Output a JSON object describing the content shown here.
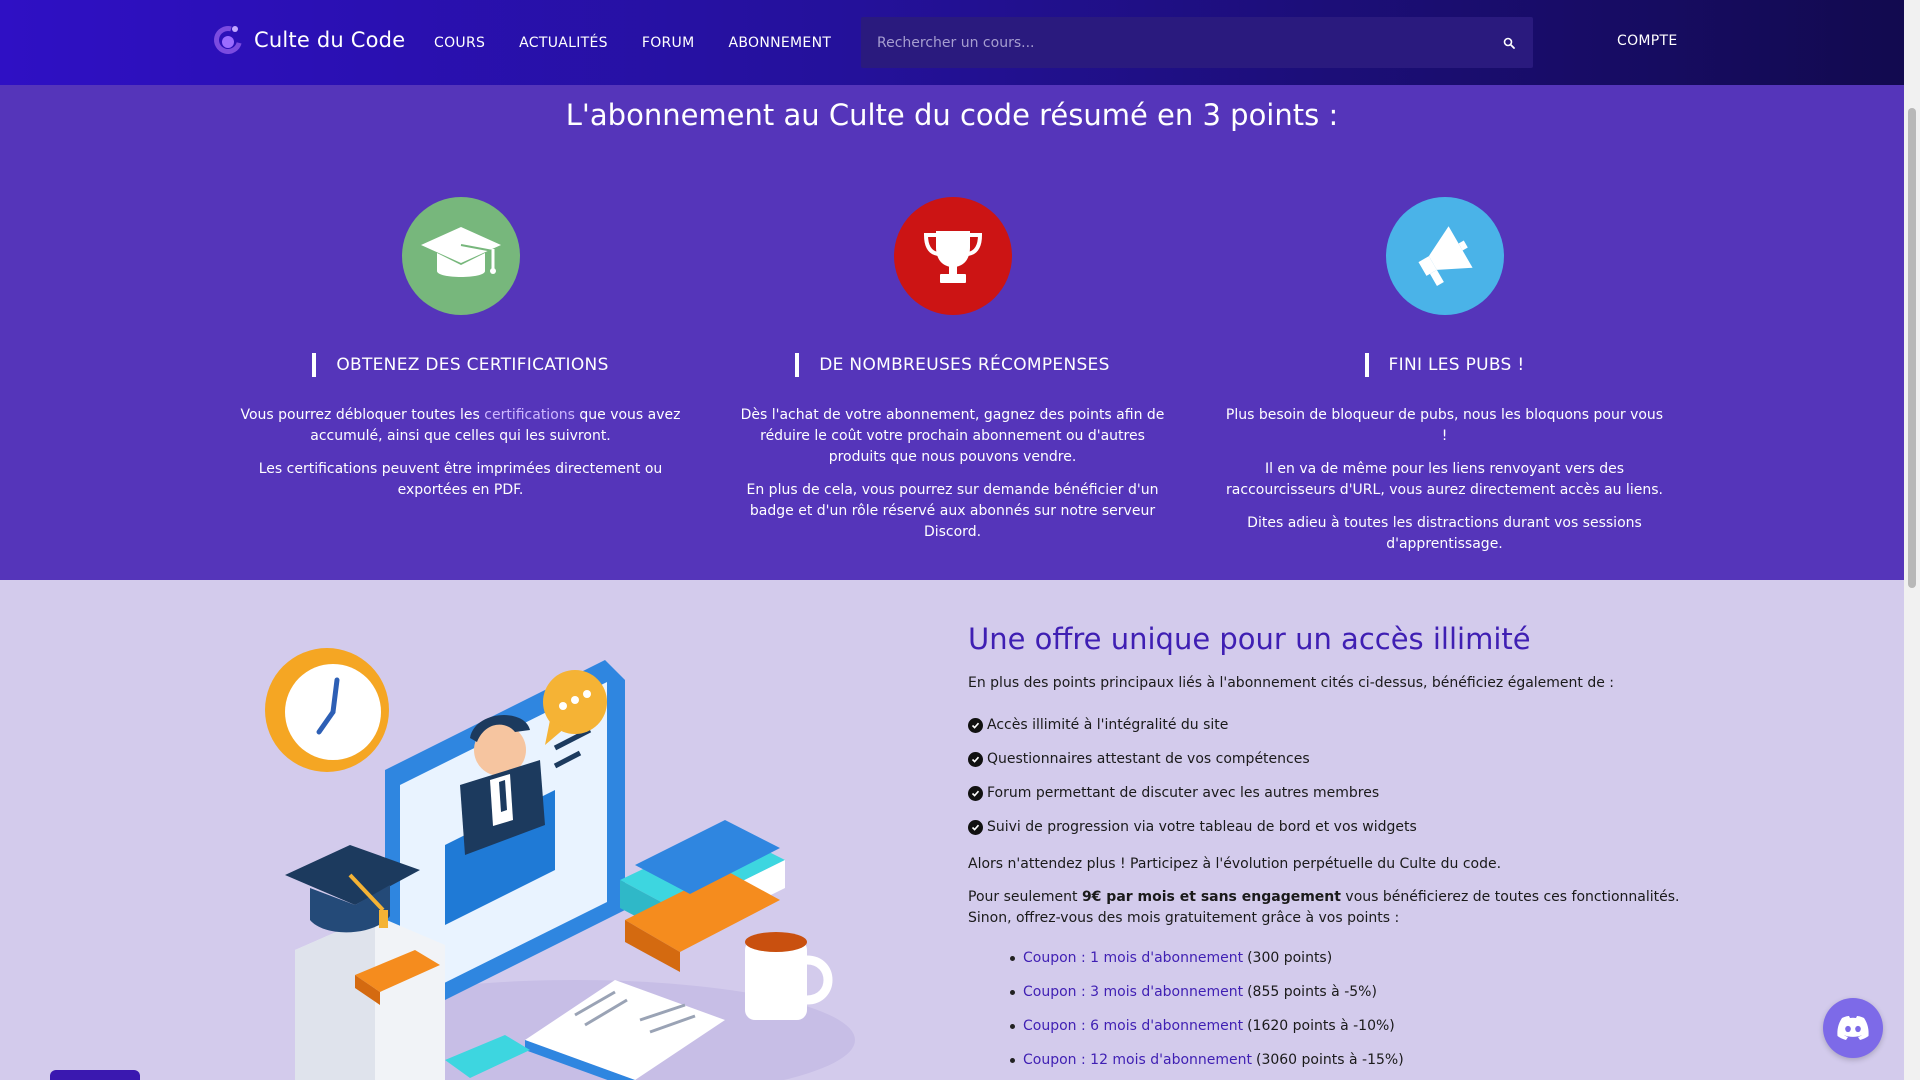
{
  "header": {
    "logo_text": "Culte du Code",
    "nav": [
      "COURS",
      "ACTUALITÉS",
      "FORUM",
      "ABONNEMENT"
    ],
    "search_placeholder": "Rechercher un cours...",
    "account_label": "COMPTE"
  },
  "features": {
    "title": "L'abonnement au Culte du code résumé en 3 points :",
    "items": [
      {
        "title": "OBTENEZ DES CERTIFICATIONS",
        "p1_before": "Vous pourrez débloquer toutes les ",
        "p1_link": "certifications",
        "p1_after": " que vous avez accumulé, ainsi que celles qui les suivront.",
        "p2": "Les certifications peuvent être imprimées directement ou exportées en PDF.",
        "color": "#77b77c"
      },
      {
        "title": "DE NOMBREUSES RÉCOMPENSES",
        "p1": "Dès l'achat de votre abonnement, gagnez des points afin de réduire le coût votre prochain abonnement ou d'autres produits que nous pouvons vendre.",
        "p2": "En plus de cela, vous pourrez sur demande bénéficier d'un badge et d'un rôle réservé aux abonnés sur notre serveur Discord.",
        "color": "#cc1414"
      },
      {
        "title": "FINI LES PUBS !",
        "p1": "Plus besoin de bloqueur de pubs, nous les bloquons pour vous !",
        "p2": "Il en va de même pour les liens renvoyant vers des raccourcisseurs d'URL, vous aurez directement accès au liens.",
        "p3": "Dites adieu à toutes les distractions durant vos sessions d'apprentissage.",
        "color": "#4ab3e8"
      }
    ]
  },
  "offer": {
    "title": "Une offre unique pour un accès illimité",
    "intro": "En plus des points principaux liés à l'abonnement cités ci-dessus, bénéficiez également de :",
    "checks": [
      "Accès illimité à l'intégralité du site",
      "Questionnaires attestant de vos compétences",
      "Forum permettant de discuter avec les autres membres",
      "Suivi de progression via votre tableau de bord et vos widgets"
    ],
    "p2": "Alors n'attendez plus ! Participez à l'évolution perpétuelle du Culte du code.",
    "p3_before": "Pour seulement ",
    "p3_bold": "9€ par mois et sans engagement",
    "p3_after": " vous bénéficierez de toutes ces fonctionnalités. Sinon, offrez-vous des mois gratuitement grâce à vos points :",
    "coupons": [
      {
        "link": "Coupon : 1 mois d'abonnement",
        "detail": "(300 points)"
      },
      {
        "link": "Coupon : 3 mois d'abonnement",
        "detail": "(855 points à -5%)"
      },
      {
        "link": "Coupon : 6 mois d'abonnement",
        "detail": "(1620 points à -10%)"
      },
      {
        "link": "Coupon : 12 mois d'abonnement",
        "detail": "(3060 points à -15%)"
      }
    ]
  }
}
